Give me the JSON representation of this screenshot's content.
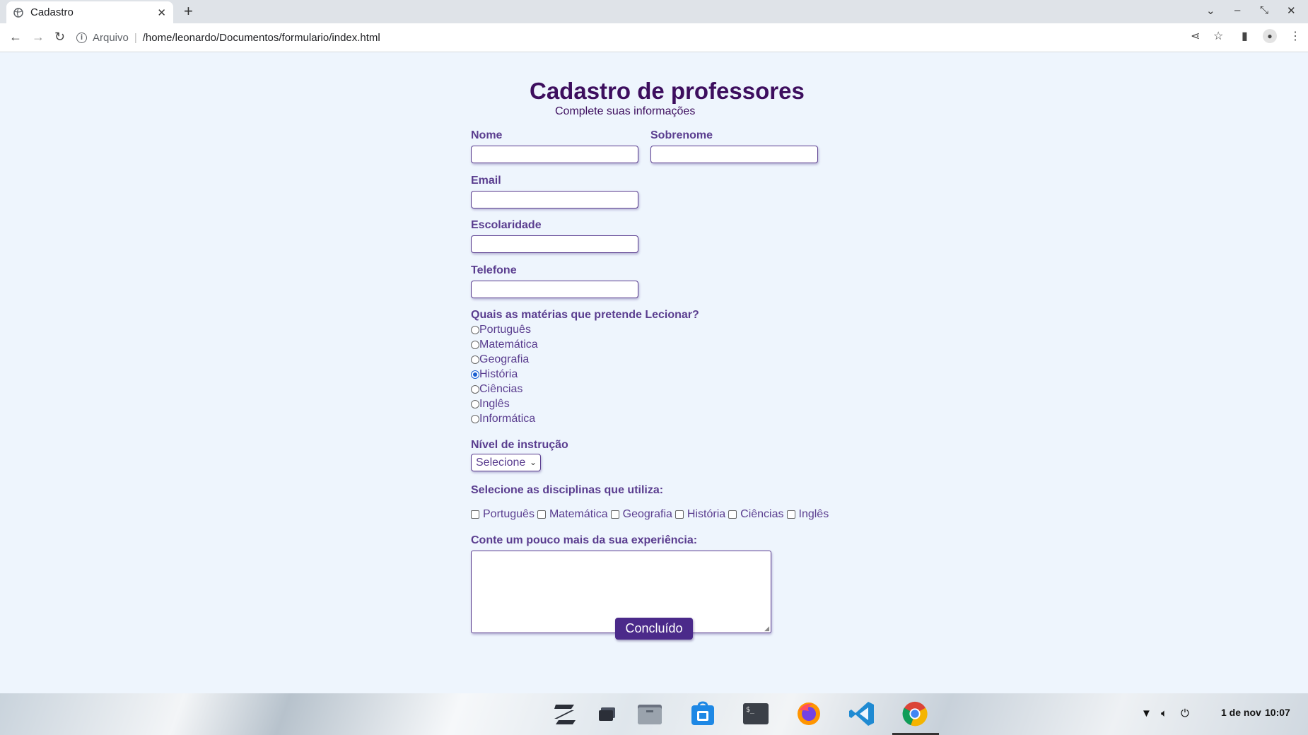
{
  "browser": {
    "tab_title": "Cadastro",
    "omnibox_scheme": "Arquivo",
    "omnibox_url": "/home/leonardo/Documentos/formulario/index.html"
  },
  "form": {
    "title": "Cadastro de professores",
    "subtitle": "Complete suas informações",
    "nome_label": "Nome",
    "sobrenome_label": "Sobrenome",
    "email_label": "Email",
    "escolaridade_label": "Escolaridade",
    "telefone_label": "Telefone",
    "nome_value": "",
    "sobrenome_value": "",
    "email_value": "",
    "escolaridade_value": "",
    "telefone_value": "",
    "materias_label": "Quais as matérias que pretende Lecionar?",
    "materias_options": [
      "Português",
      "Matemática",
      "Geografia",
      "História",
      "Ciências",
      "Inglês",
      "Informática"
    ],
    "materias_selected": "História",
    "nivel_label": "Nível de instrução",
    "nivel_selected": "Selecione",
    "disciplinas_label": "Selecione as disciplinas que utiliza:",
    "disciplinas_options": [
      "Português",
      "Matemática",
      "Geografia",
      "História",
      "Ciências",
      "Inglês"
    ],
    "experiencia_label": "Conte um pouco mais da sua experiência:",
    "experiencia_value": "",
    "submit_label": "Concluído"
  },
  "taskbar": {
    "apps": [
      "zorin-menu-icon",
      "window-switcher-icon",
      "files-icon",
      "software-store-icon",
      "terminal-icon",
      "firefox-icon",
      "vscode-icon",
      "chrome-icon"
    ],
    "date": "1 de nov",
    "time": "10:07"
  },
  "colors": {
    "page_bg": "#eef5fd",
    "title": "#3d0e5e",
    "label": "#5a3d8f",
    "button": "#4b2a8a"
  }
}
